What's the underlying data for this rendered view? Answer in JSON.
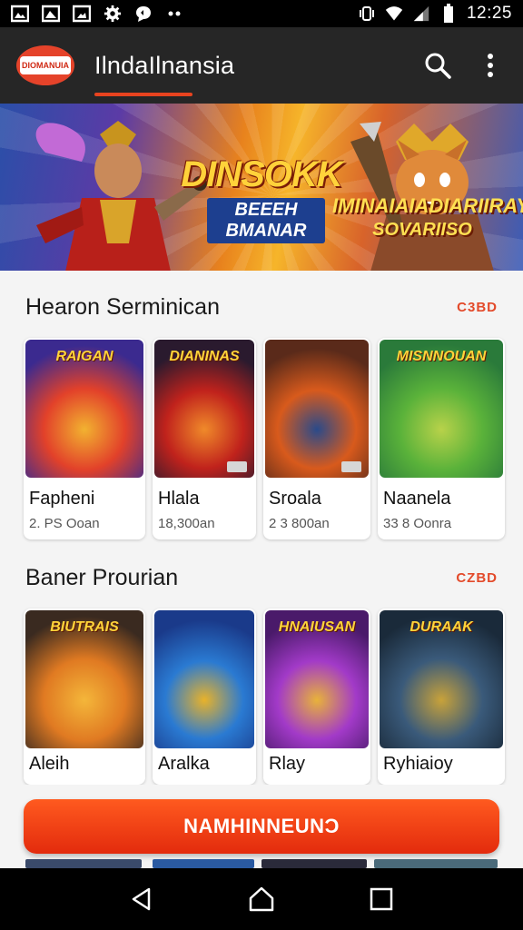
{
  "status_bar": {
    "time": "12:25",
    "icons": [
      "image-icon",
      "gallery-icon",
      "photo-icon",
      "settings-gear-icon",
      "chat-icon",
      "more-dots-icon",
      "vibrate-icon",
      "wifi-icon",
      "signal-icon",
      "battery-icon"
    ]
  },
  "app_bar": {
    "logo_text": "DIOMANUIA",
    "title": "IlndaIlnansia",
    "actions": [
      "search-icon",
      "overflow-menu-icon"
    ]
  },
  "banner": {
    "title": "DINSOKK",
    "subtitle": "BEEEH BMANAR",
    "promo_line1": "IMINAIAIADIARIIRAY",
    "promo_line2": "SOVARIISO"
  },
  "sections": [
    {
      "title": "Hearon Serminican",
      "more": "C3BD",
      "cards": [
        {
          "name": "Fapheni",
          "sub": "2. PS Ooan",
          "art_title": "RAIGAN",
          "colors": [
            "#3b2a8f",
            "#e2412a",
            "#f2b230"
          ]
        },
        {
          "name": "Hlala",
          "sub": "18,300an",
          "art_title": "DIANINAS",
          "colors": [
            "#2a1a2e",
            "#c0221c",
            "#f08a2a"
          ]
        },
        {
          "name": "Sroala",
          "sub": "2 3 800an",
          "art_title": "",
          "colors": [
            "#5a2a1a",
            "#d85a1c",
            "#2a4a8a"
          ]
        },
        {
          "name": "Naanela",
          "sub": "33 8 Oonra",
          "art_title": "MISNNOUAN",
          "colors": [
            "#2a7a3a",
            "#5ab23a",
            "#b8d24a"
          ]
        }
      ]
    },
    {
      "title": "Baner Prourian",
      "more": "CZBD",
      "cards": [
        {
          "name": "Aleih",
          "sub": "",
          "art_title": "BIUTRAIS",
          "colors": [
            "#3a2a20",
            "#e07a22",
            "#f4b63a"
          ]
        },
        {
          "name": "Aralka",
          "sub": "",
          "art_title": "",
          "colors": [
            "#1a3a8a",
            "#2a7ad2",
            "#e8b22a"
          ]
        },
        {
          "name": "Rlay",
          "sub": "",
          "art_title": "HNAIUSAN",
          "colors": [
            "#4a1a6a",
            "#a23ac8",
            "#e8b23a"
          ]
        },
        {
          "name": "Ryhiaioy",
          "sub": "",
          "art_title": "DURAAK",
          "colors": [
            "#1a2a3a",
            "#3a5a7a",
            "#c8a23a"
          ]
        }
      ]
    }
  ],
  "cta": {
    "label": "NAMHINNEUNƆ"
  },
  "nav_bar": {
    "buttons": [
      "back-icon",
      "home-icon",
      "recents-icon"
    ]
  }
}
